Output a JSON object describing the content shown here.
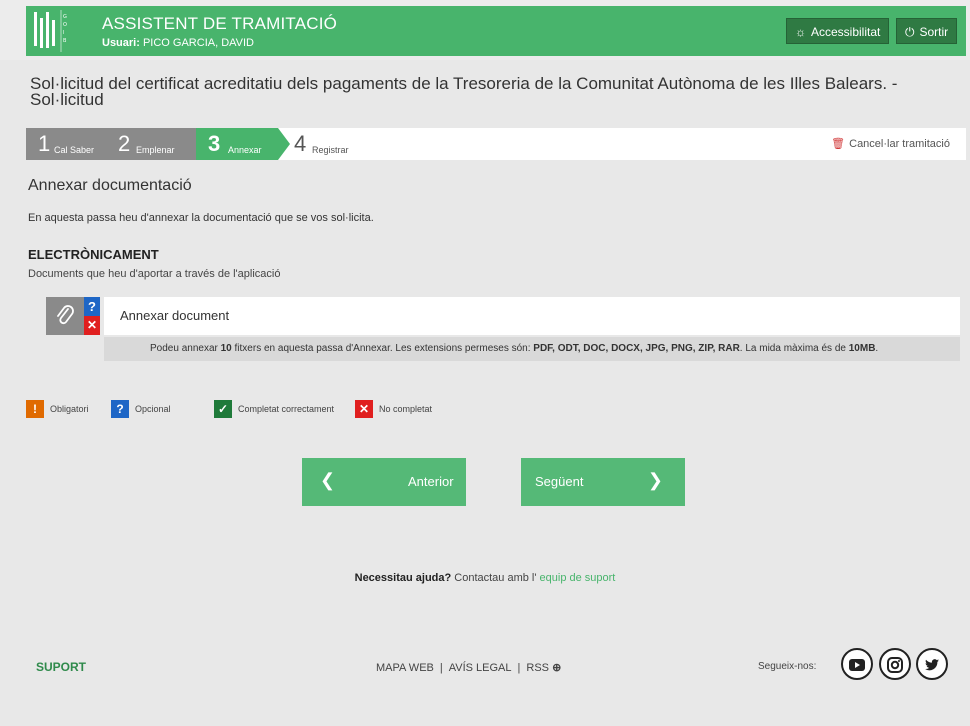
{
  "header": {
    "title": "ASSISTENT DE TRAMITACIÓ",
    "user_label": "Usuari:",
    "user_name": "PICO GARCIA, DAVID",
    "logo_text": "GOIB",
    "accessibility_label": "Accessibilitat",
    "exit_label": "Sortir"
  },
  "page": {
    "title": "Sol·licitud del certificat acreditatiu dels pagaments de la Tresoreria de la Comunitat Autònoma de les Illes Balears. - Sol·licitud"
  },
  "steps": [
    {
      "num": "1",
      "label": "Cal Saber"
    },
    {
      "num": "2",
      "label": "Emplenar"
    },
    {
      "num": "3",
      "label": "Annexar"
    },
    {
      "num": "4",
      "label": "Registrar"
    }
  ],
  "cancel_label": "Cancel·lar tramitació",
  "section": {
    "title": "Annexar documentació",
    "description": "En aquesta passa heu d'annexar la documentació que se vos sol·licita.",
    "electronic_title": "ELECTRÒNICAMENT",
    "electronic_sub": "Documents que heu d'aportar a través de l'aplicació"
  },
  "document": {
    "name": "Annexar document",
    "note_part1": "Podeu annexar ",
    "note_count": "10",
    "note_part2": " fitxers en aquesta passa d'Annexar.  Les extensions permeses són: ",
    "note_exts": "PDF, ODT, DOC, DOCX, JPG, PNG, ZIP, RAR",
    "note_part3": ".  La mida màxima és de ",
    "note_size": "10MB",
    "note_end": "."
  },
  "legend": {
    "mandatory": "Obligatori",
    "optional": "Opcional",
    "completed": "Completat correctament",
    "not_completed": "No completat"
  },
  "nav": {
    "prev": "Anterior",
    "next": "Següent"
  },
  "help": {
    "question": "Necessitau ajuda?",
    "text": " Contactau amb l' ",
    "link": "equip de suport"
  },
  "footer": {
    "suport": "SUPORT",
    "links": [
      "MAPA WEB",
      "AVÍS LEGAL",
      "RSS"
    ],
    "follow": "Segueix-nos:"
  },
  "colors": {
    "brand_green": "#48b46c",
    "mandatory": "#e06a00",
    "optional": "#1e66c6",
    "completed": "#1f7a3a",
    "not_completed": "#e01f1f"
  }
}
